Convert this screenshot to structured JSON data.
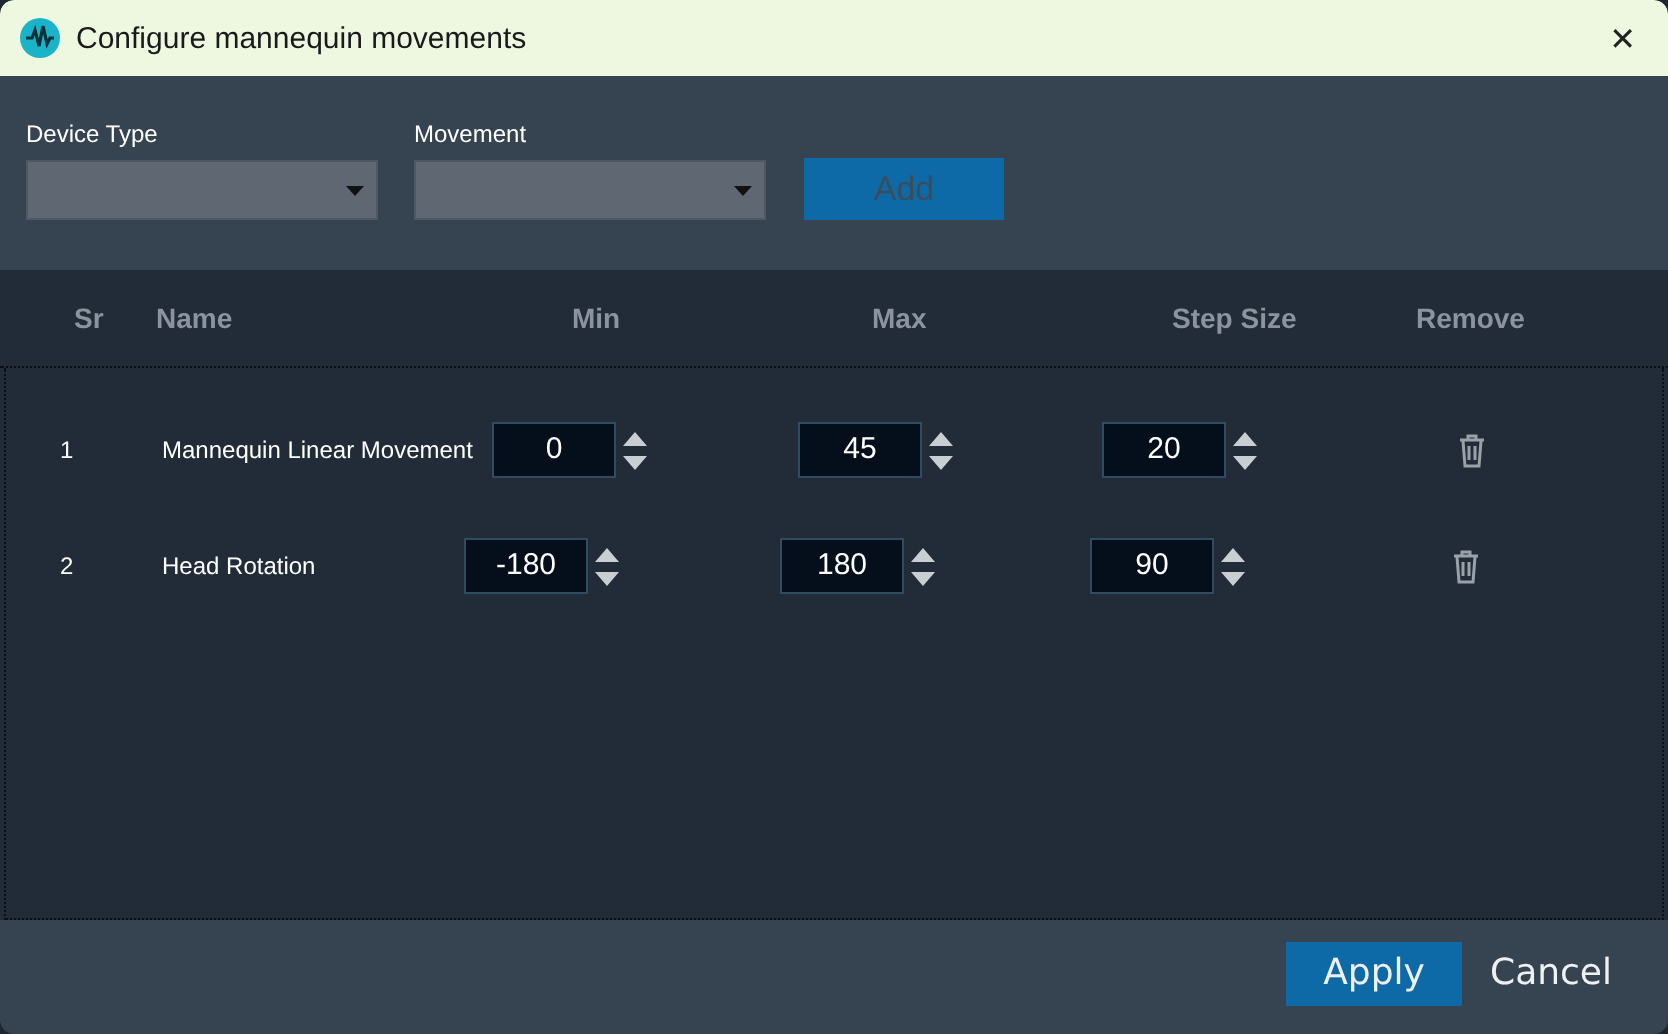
{
  "window": {
    "title": "Configure mannequin movements",
    "close": "✕"
  },
  "filters": [
    {
      "label": "Device Type",
      "kind": "dropdown"
    },
    {
      "label": "Movement",
      "kind": "dropdown"
    }
  ],
  "add_button": {
    "label": "Add",
    "disabled": true
  },
  "table": {
    "columns": [
      "Sr",
      "Name",
      "Min",
      "Max",
      "Step Size",
      "Remove"
    ],
    "rows": [
      {
        "sr": "1",
        "name": "Mannequin Linear Movement",
        "min": "0",
        "max": "45",
        "step": "20"
      },
      {
        "sr": "2",
        "name": "Head Rotation",
        "min": "-180",
        "max": "180",
        "step": "90"
      }
    ]
  },
  "buttons": [
    {
      "label": "Apply",
      "kind": "primary"
    },
    {
      "label": "Cancel",
      "kind": "plain"
    }
  ]
}
